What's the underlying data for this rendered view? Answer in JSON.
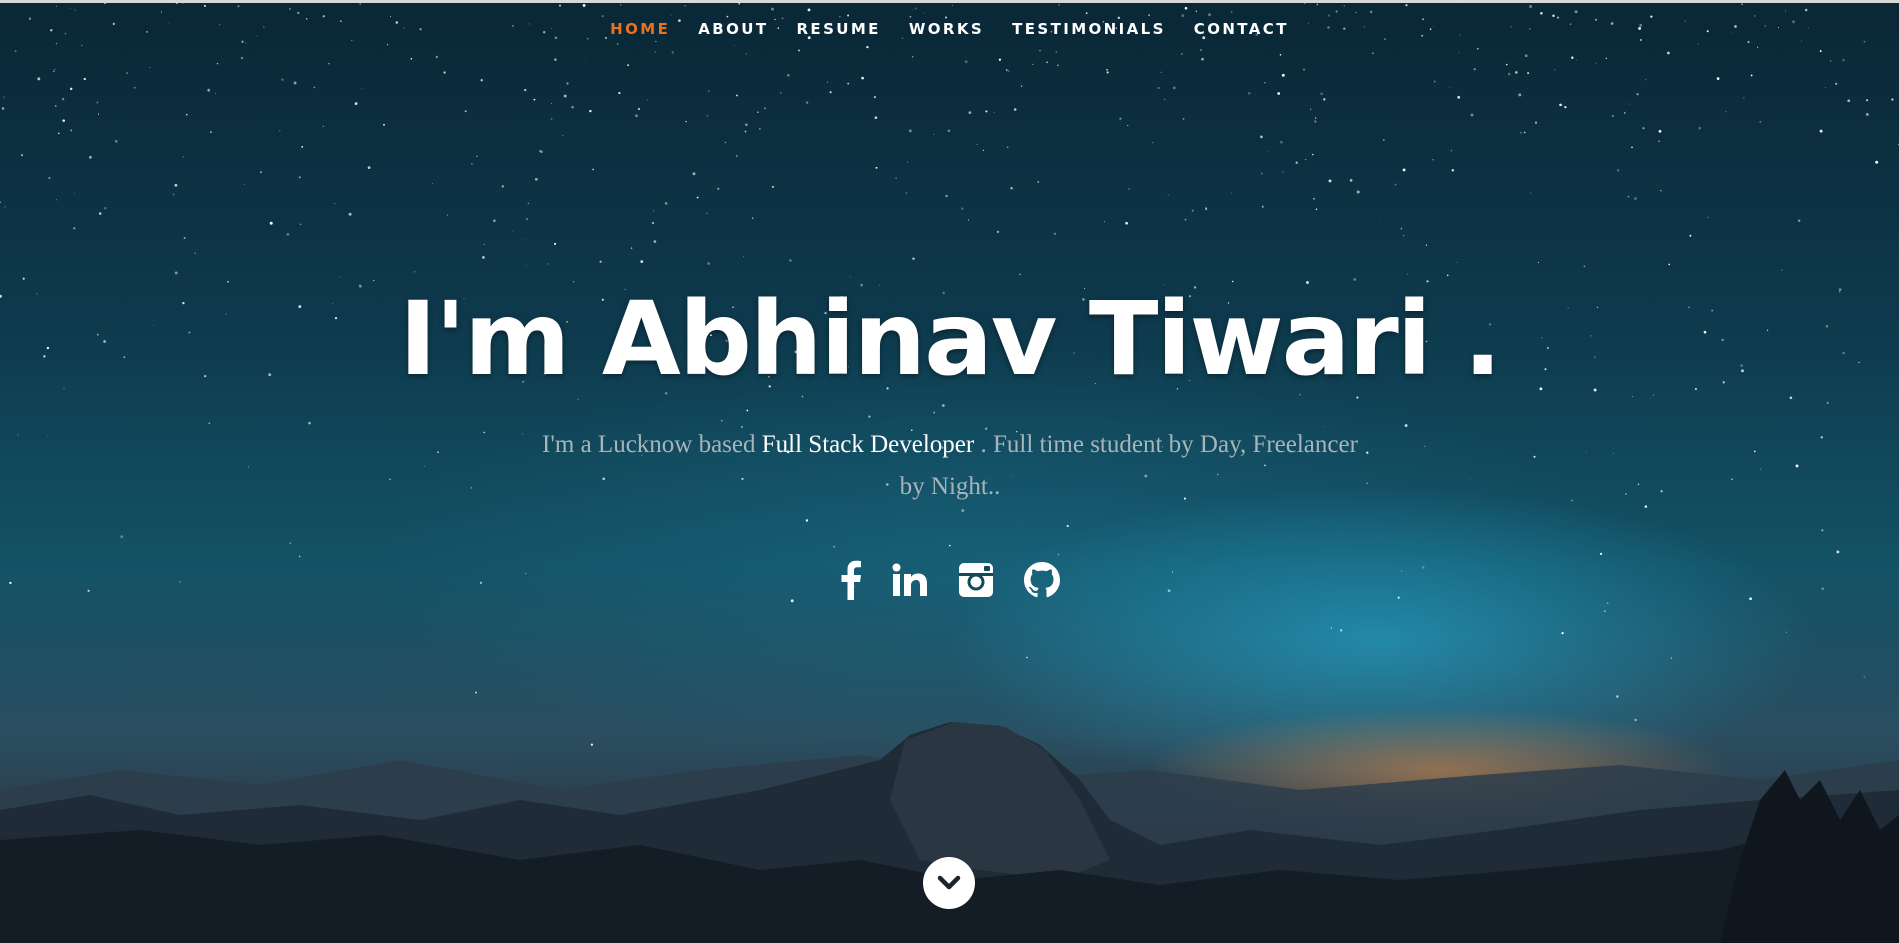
{
  "nav": {
    "items": [
      {
        "label": "HOME",
        "active": true
      },
      {
        "label": "ABOUT",
        "active": false
      },
      {
        "label": "RESUME",
        "active": false
      },
      {
        "label": "WORKS",
        "active": false
      },
      {
        "label": "TESTIMONIALS",
        "active": false
      },
      {
        "label": "CONTACT",
        "active": false
      }
    ],
    "active_color": "#e8731d"
  },
  "hero": {
    "headline": "I'm Abhinav Tiwari .",
    "intro_prefix": "I'm a Lucknow based ",
    "intro_highlight": "Full Stack Developer",
    "intro_suffix": " . Full time student by Day, Freelancer by Night.."
  },
  "social": [
    {
      "icon": "facebook-icon"
    },
    {
      "icon": "linkedin-icon"
    },
    {
      "icon": "instagram-icon"
    },
    {
      "icon": "github-icon"
    }
  ],
  "scroll": {
    "icon": "chevron-down-icon"
  }
}
